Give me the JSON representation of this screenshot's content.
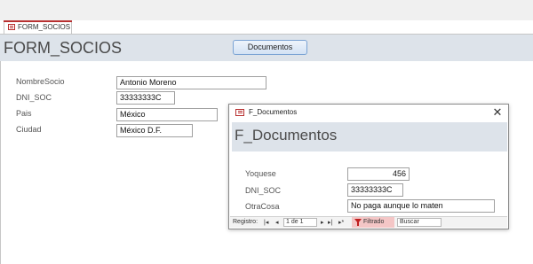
{
  "tab": {
    "label": "FORM_SOCIOS"
  },
  "main": {
    "title": "FORM_SOCIOS",
    "documentos_button": "Documentos",
    "fields": [
      {
        "label": "NombreSocio",
        "value": "Antonio Moreno"
      },
      {
        "label": "DNI_SOC",
        "value": "33333333C"
      },
      {
        "label": "Pais",
        "value": "México"
      },
      {
        "label": "Ciudad",
        "value": "México D.F."
      }
    ]
  },
  "popup": {
    "window_title": "F_Documentos",
    "header_title": "F_Documentos",
    "close_glyph": "✕",
    "fields": [
      {
        "label": "Yoquese",
        "value": "456"
      },
      {
        "label": "DNI_SOC",
        "value": "33333333C"
      },
      {
        "label": "OtraCosa",
        "value": "No paga aunque lo maten"
      }
    ],
    "nav": {
      "registro_label": "Registro:",
      "first": "|◂",
      "prev": "◂",
      "position": "1 de 1",
      "next": "▸",
      "last": "▸|",
      "new": "▸*",
      "filter_label": "Filtrado",
      "search_placeholder": "Buscar"
    }
  },
  "colors": {
    "accent": "#b83030",
    "header_bg": "#dde3ea"
  }
}
